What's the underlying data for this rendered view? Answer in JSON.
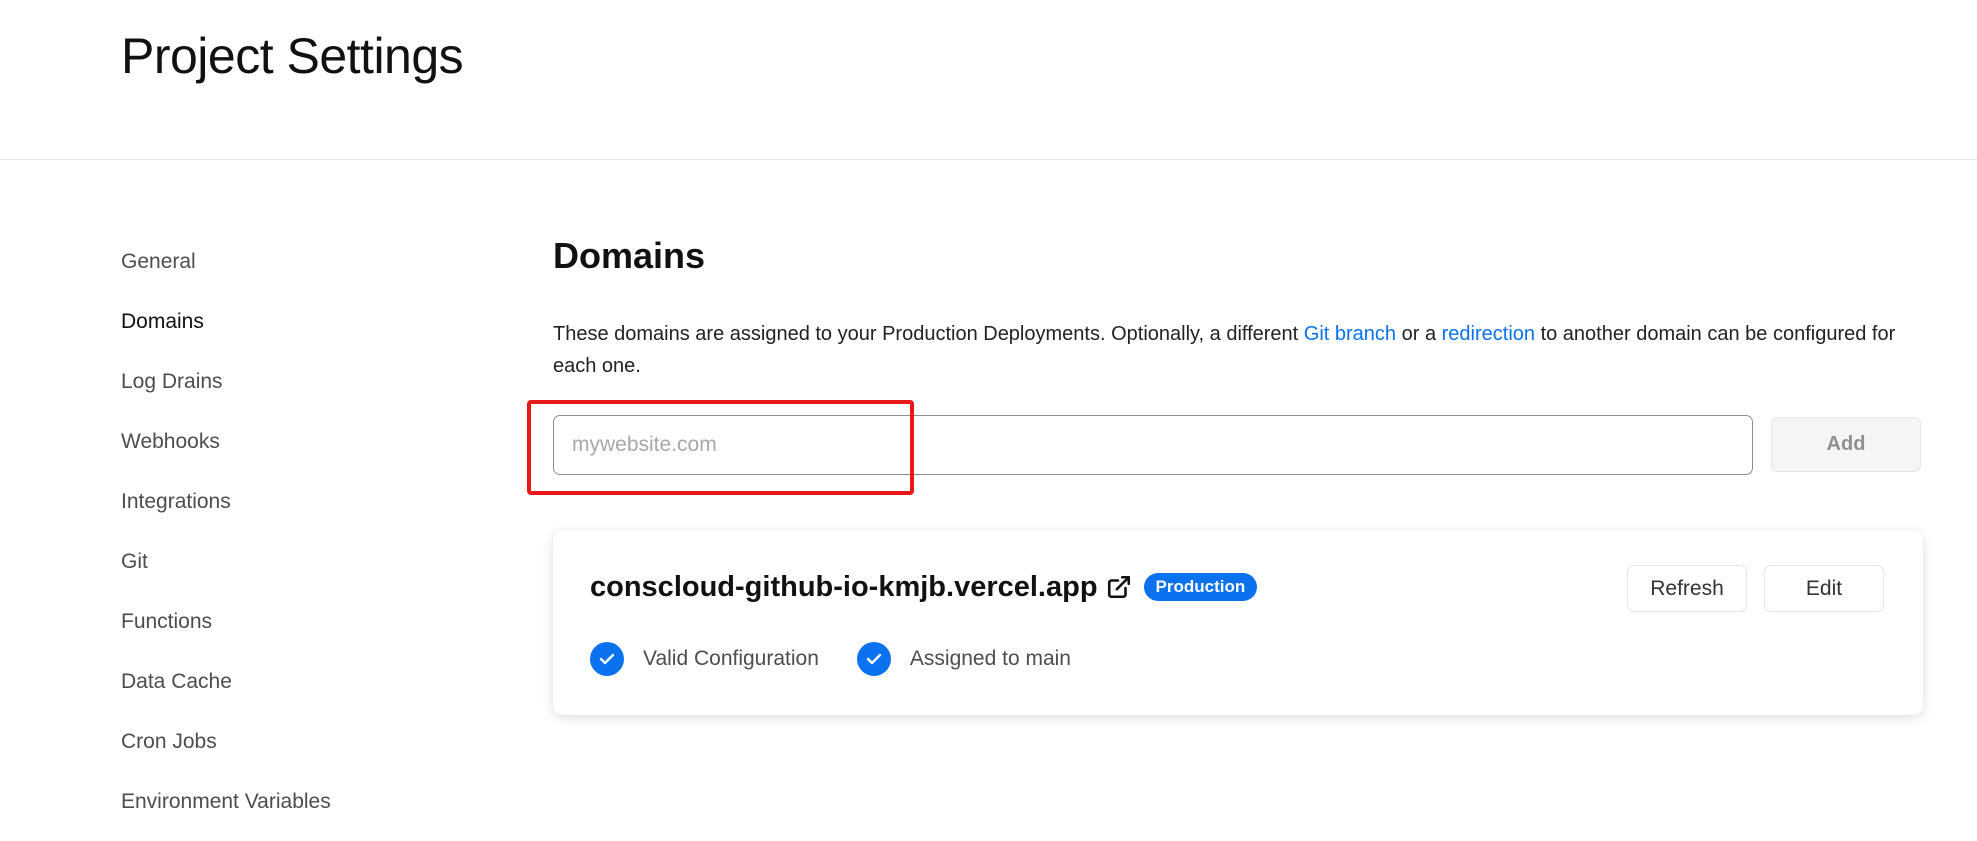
{
  "header": {
    "title": "Project Settings"
  },
  "sidebar": {
    "items": [
      {
        "label": "General",
        "active": false
      },
      {
        "label": "Domains",
        "active": true
      },
      {
        "label": "Log Drains",
        "active": false
      },
      {
        "label": "Webhooks",
        "active": false
      },
      {
        "label": "Integrations",
        "active": false
      },
      {
        "label": "Git",
        "active": false
      },
      {
        "label": "Functions",
        "active": false
      },
      {
        "label": "Data Cache",
        "active": false
      },
      {
        "label": "Cron Jobs",
        "active": false
      },
      {
        "label": "Environment Variables",
        "active": false
      }
    ]
  },
  "main": {
    "section_title": "Domains",
    "description": {
      "part1": "These domains are assigned to your Production Deployments. Optionally, a different ",
      "link1": "Git branch",
      "part2": " or a ",
      "link2": "redirection",
      "part3": " to another domain can be configured for each one."
    },
    "add_domain": {
      "placeholder": "mywebsite.com",
      "value": "",
      "button_label": "Add"
    },
    "domain_card": {
      "domain": "conscloud-github-io-kmjb.vercel.app",
      "badge": "Production",
      "refresh_label": "Refresh",
      "edit_label": "Edit",
      "statuses": [
        {
          "label": "Valid Configuration",
          "icon": "check-circle-icon"
        },
        {
          "label": "Assigned to main",
          "icon": "check-circle-icon"
        }
      ]
    }
  },
  "colors": {
    "accent": "#0a72ef",
    "highlight": "#e8181b",
    "muted_text": "#4d4d4d"
  }
}
